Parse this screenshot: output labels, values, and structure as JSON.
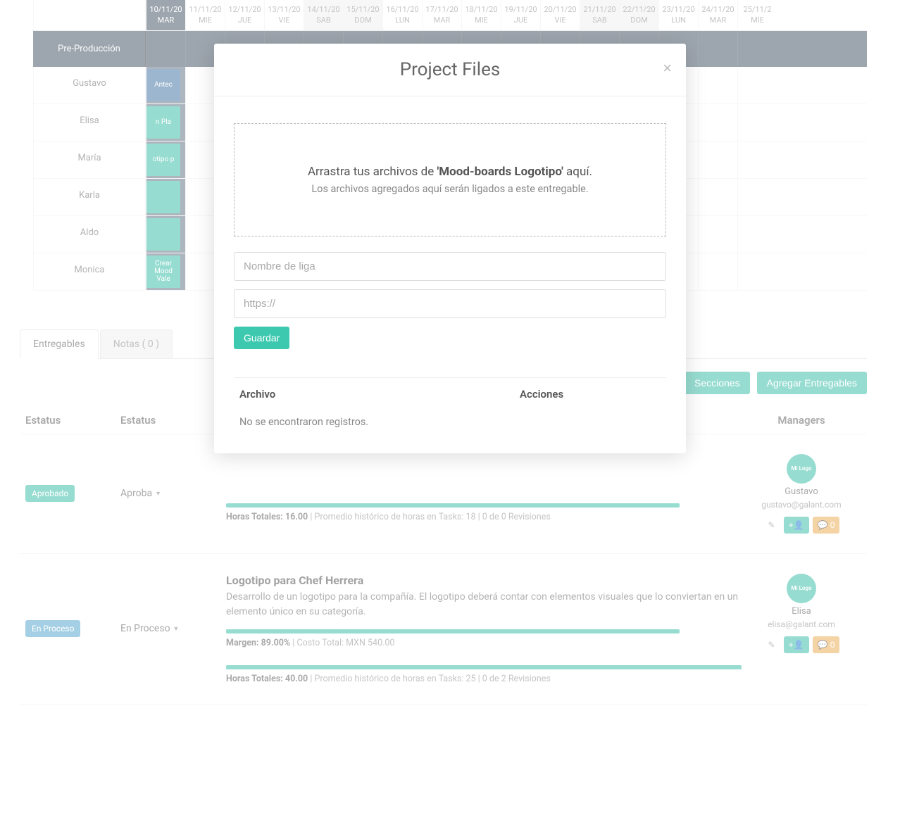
{
  "gantt": {
    "dates": [
      {
        "date": "10/11/20",
        "day": "MAR",
        "selected": true
      },
      {
        "date": "11/11/20",
        "day": "MIE"
      },
      {
        "date": "12/11/20",
        "day": "JUE"
      },
      {
        "date": "13/11/20",
        "day": "VIE"
      },
      {
        "date": "14/11/20",
        "day": "SAB",
        "weekend": true
      },
      {
        "date": "15/11/20",
        "day": "DOM",
        "weekend": true
      },
      {
        "date": "16/11/20",
        "day": "LUN"
      },
      {
        "date": "17/11/20",
        "day": "MAR"
      },
      {
        "date": "18/11/20",
        "day": "MIE"
      },
      {
        "date": "19/11/20",
        "day": "JUE"
      },
      {
        "date": "20/11/20",
        "day": "VIE"
      },
      {
        "date": "21/11/20",
        "day": "SAB",
        "weekend": true
      },
      {
        "date": "22/11/20",
        "day": "DOM",
        "weekend": true
      },
      {
        "date": "23/11/20",
        "day": "LUN"
      },
      {
        "date": "24/11/20",
        "day": "MAR"
      },
      {
        "date": "25/11/2",
        "day": "MIE"
      }
    ],
    "section": "Pre-Producción",
    "rows": [
      {
        "name": "Gustavo",
        "task": "Antec",
        "cls": "blue"
      },
      {
        "name": "Elisa",
        "task": "n Pla"
      },
      {
        "name": "María",
        "task": "otipo p"
      },
      {
        "name": "Karla",
        "task": ""
      },
      {
        "name": "Aldo",
        "task": ""
      },
      {
        "name": "Monica",
        "task": "Crear Mood Vale"
      }
    ]
  },
  "tabs": {
    "entregables": "Entregables",
    "notas": "Notas ( 0 )"
  },
  "toolbar": {
    "secciones": "Secciones",
    "agregar": "Agregar Entregables"
  },
  "headers": {
    "estatus1": "Estatus",
    "estatus2": "Estatus",
    "managers": "Managers"
  },
  "deliverables": [
    {
      "badge": "Aprobado",
      "status": "Aproba",
      "title": "",
      "desc": "",
      "margin_label": "",
      "hours_label": "Horas Totales: 16.00",
      "hours_meta": "| Promedio histórico de horas en Tasks: 18 | 0 de 0 Revisiones",
      "manager": {
        "name": "Gustavo",
        "email": "gustavo@galant.com",
        "avatar": "Mi Logo"
      },
      "comment_count": "0"
    },
    {
      "badge": "En Proceso",
      "status": "En Proceso",
      "title": "Logotipo para Chef Herrera",
      "desc": "Desarrollo de un logotipo para la compañía. El logotipo deberá contar con elementos visuales que lo conviertan en un elemento único en su categoría.",
      "margin_label": "Margen: 89.00%",
      "margin_meta": "| Costo Total: MXN 540.00",
      "hours_label": "Horas Totales: 40.00",
      "hours_meta": "| Promedio histórico de horas en Tasks: 25 | 0 de 2 Revisiones",
      "manager": {
        "name": "Elisa",
        "email": "elisa@galant.com",
        "avatar": "Mi Logo"
      },
      "comment_count": "0"
    }
  ],
  "modal": {
    "title": "Project Files",
    "dropzone_pre": "Arrastra tus archivos de ",
    "dropzone_bold": "'Mood-boards Logotipo'",
    "dropzone_post": " aquí.",
    "dropzone_sub": "Los archivos agregados aquí serán ligados a este entregable.",
    "placeholder_name": "Nombre de liga",
    "placeholder_url": "https://",
    "save": "Guardar",
    "th_file": "Archivo",
    "th_actions": "Acciones",
    "empty": "No se encontraron registros."
  }
}
